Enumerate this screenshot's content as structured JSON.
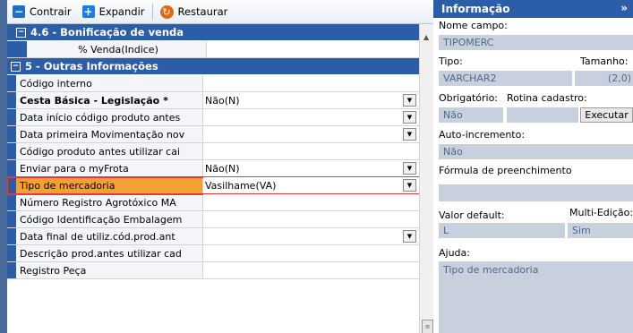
{
  "toolbar": {
    "contrair": "Contrair",
    "expandir": "Expandir",
    "restaurar": "Restaurar"
  },
  "groups": {
    "g46": "4.6 - Bonificação de venda",
    "g5": "5 - Outras Informações"
  },
  "rows": [
    {
      "name": "% Venda(Indice)",
      "value": "",
      "dropdown": false,
      "style": "sub"
    },
    {
      "name": "Código interno",
      "value": "",
      "dropdown": false,
      "style": ""
    },
    {
      "name": "Cesta Básica - Legislação *",
      "value": "Não(N)",
      "dropdown": true,
      "style": "bold"
    },
    {
      "name": "Data início código produto antes",
      "value": "",
      "dropdown": true,
      "style": ""
    },
    {
      "name": "Data primeira Movimentação nov",
      "value": "",
      "dropdown": true,
      "style": ""
    },
    {
      "name": "Código produto antes utilizar cai",
      "value": "",
      "dropdown": false,
      "style": ""
    },
    {
      "name": "Enviar para o myFrota",
      "value": "Não(N)",
      "dropdown": true,
      "style": ""
    },
    {
      "name": "Tipo de mercadoria",
      "value": "Vasilhame(VA)",
      "dropdown": true,
      "style": "hl"
    },
    {
      "name": "Número Registro Agrotóxico MA",
      "value": "",
      "dropdown": false,
      "style": ""
    },
    {
      "name": "Código Identificação Embalagem",
      "value": "",
      "dropdown": false,
      "style": ""
    },
    {
      "name": "Data final de utiliz.cód.prod.ant",
      "value": "",
      "dropdown": true,
      "style": ""
    },
    {
      "name": "Descrição prod.antes utilizar cad",
      "value": "",
      "dropdown": false,
      "style": ""
    },
    {
      "name": "Registro Peça",
      "value": "",
      "dropdown": false,
      "style": ""
    }
  ],
  "info": {
    "title": "Informação",
    "nome_campo_label": "Nome campo:",
    "nome_campo_value": "TIPOMERC",
    "tipo_label": "Tipo:",
    "tamanho_label": "Tamanho:",
    "tipo_value": "VARCHAR2",
    "tamanho_value": "(2,0)",
    "obrigatorio_label": "Obrigatório:",
    "rotina_label": "Rotina cadastro:",
    "obrigatorio_value": "Não",
    "executar_label": "Executar",
    "autoinc_label": "Auto-incremento:",
    "autoinc_value": "Não",
    "formula_label": "Fórmula de preenchimento",
    "formula_value": "",
    "default_label": "Valor default:",
    "multi_label": "Multi-Edição:",
    "default_value": "L",
    "multi_value": "Sim",
    "ajuda_label": "Ajuda:",
    "ajuda_value": "Tipo de mercadoria"
  },
  "colors": {
    "group_blue": "#2b5da8",
    "highlight_orange": "#f3a133",
    "highlight_border": "#e53935"
  }
}
